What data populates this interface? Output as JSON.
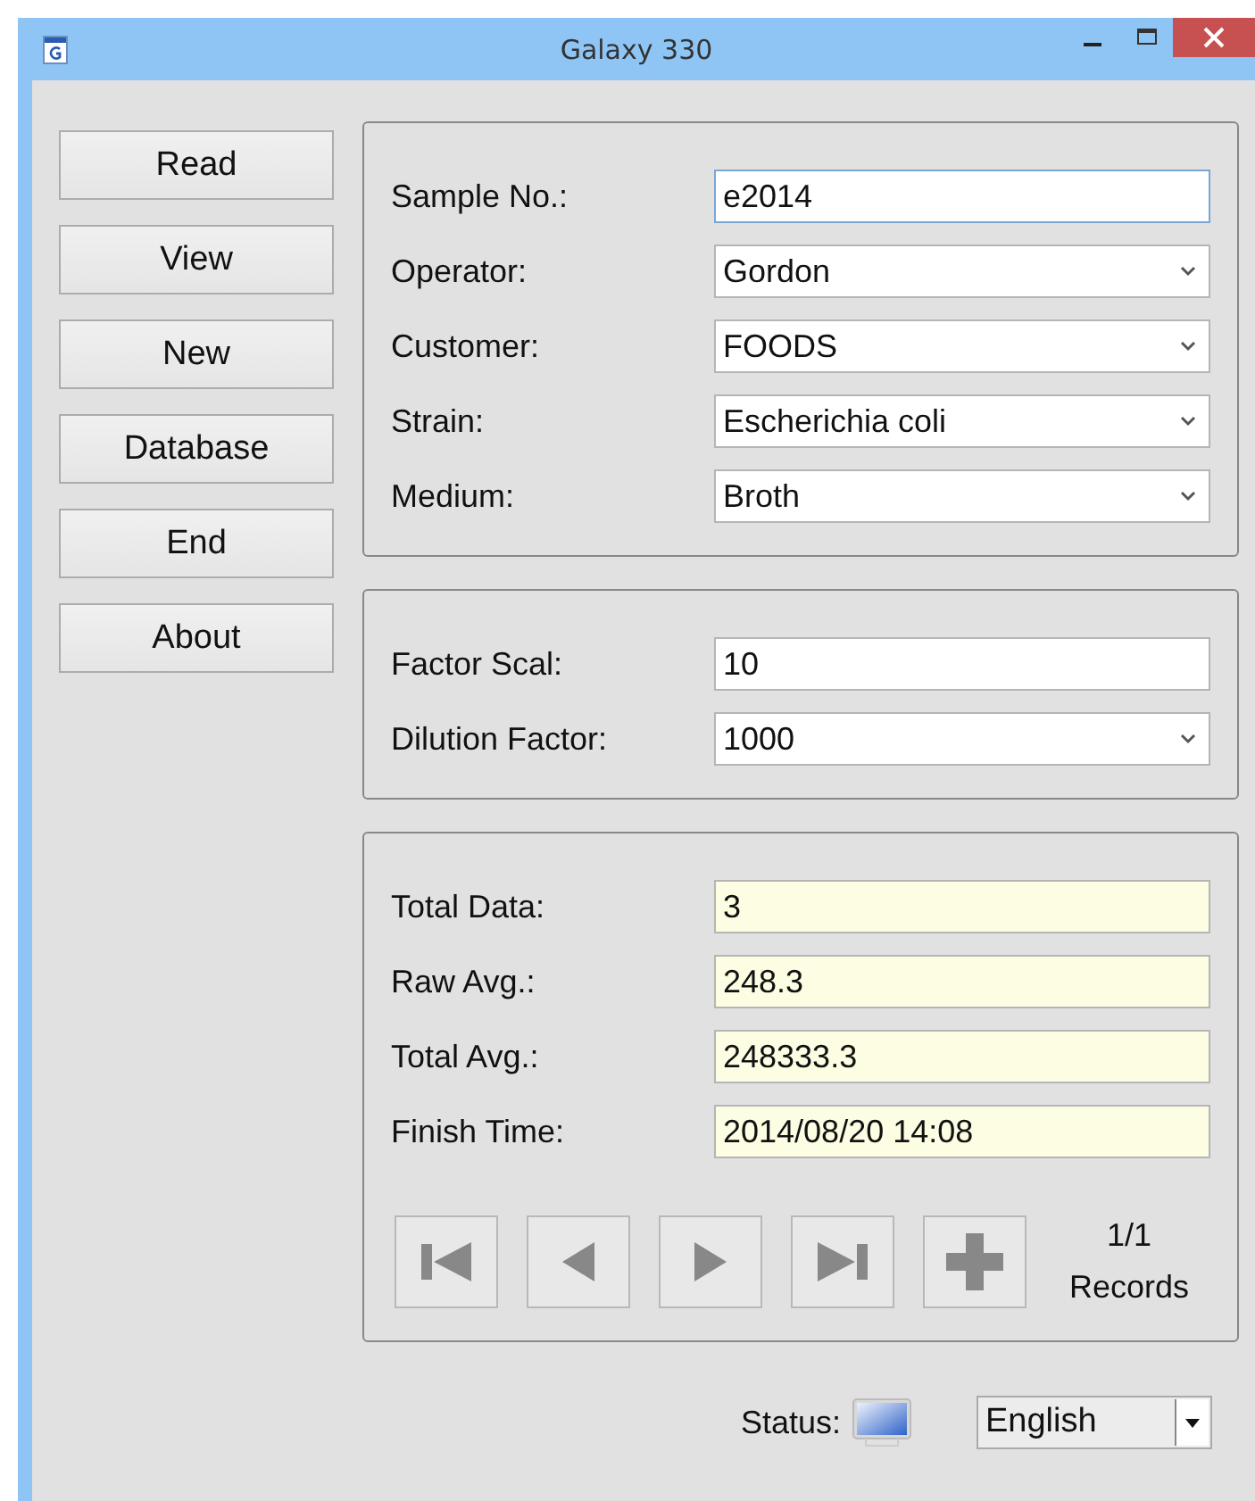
{
  "window": {
    "title": "Galaxy 330"
  },
  "menu_buttons": [
    "Read",
    "View",
    "New",
    "Database",
    "End",
    "About"
  ],
  "panels": [
    {
      "fields": [
        {
          "label": "Sample No.:",
          "kind": "text",
          "value": "e2014",
          "focused": true
        },
        {
          "label": "Operator:",
          "kind": "select",
          "value": "Gordon",
          "focused": false
        },
        {
          "label": "Customer:",
          "kind": "select",
          "value": "FOODS",
          "focused": false
        },
        {
          "label": "Strain:",
          "kind": "select",
          "value": "Escherichia coli",
          "focused": false
        },
        {
          "label": "Medium:",
          "kind": "select",
          "value": "Broth",
          "focused": false
        }
      ]
    },
    {
      "fields": [
        {
          "label": "Factor Scal:",
          "kind": "text",
          "value": "10",
          "focused": false
        },
        {
          "label": "Dilution Factor:",
          "kind": "select",
          "value": "1000",
          "focused": false
        }
      ]
    },
    {
      "fields": [
        {
          "label": "Total Data:",
          "kind": "readonly",
          "value": "3",
          "focused": false
        },
        {
          "label": "Raw Avg.:",
          "kind": "readonly",
          "value": "248.3",
          "focused": false
        },
        {
          "label": "Total Avg.:",
          "kind": "readonly",
          "value": "248333.3",
          "focused": false
        },
        {
          "label": "Finish Time:",
          "kind": "readonly",
          "value": "2014/08/20 14:08",
          "focused": false
        }
      ],
      "nav_buttons": [
        {
          "kind": "first"
        },
        {
          "kind": "prev"
        },
        {
          "kind": "next"
        },
        {
          "kind": "last"
        },
        {
          "kind": "add"
        }
      ],
      "record_position": "1/1",
      "record_label": "Records"
    }
  ],
  "status": {
    "label": "Status:"
  },
  "language": {
    "value": "English"
  }
}
